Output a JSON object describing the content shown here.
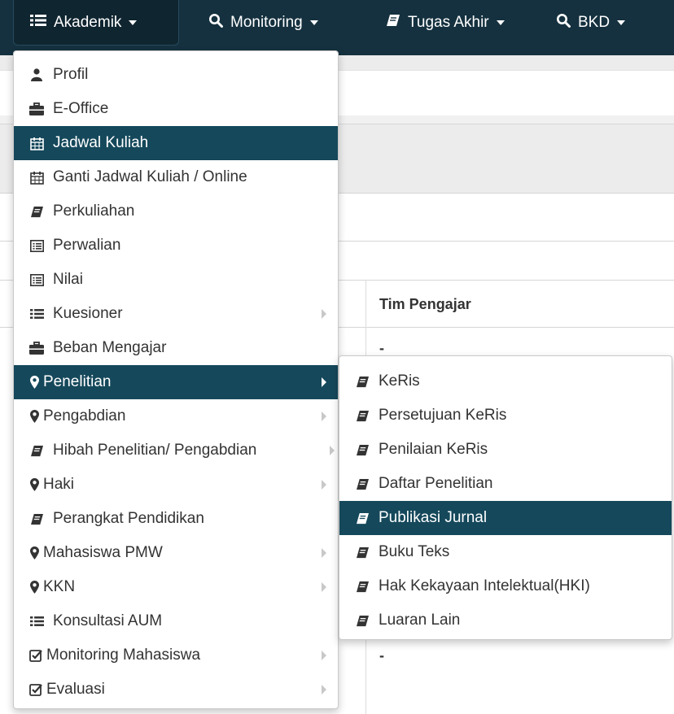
{
  "navbar": {
    "items": [
      {
        "label": "Akademik",
        "icon": "list-icon"
      },
      {
        "label": "Monitoring",
        "icon": "search-icon"
      },
      {
        "label": "Tugas Akhir",
        "icon": "book-icon"
      },
      {
        "label": "BKD",
        "icon": "search-icon"
      }
    ]
  },
  "table": {
    "header_tim_pengajar": "Tim Pengajar",
    "dash": "-"
  },
  "akademik_menu": {
    "items": [
      {
        "label": "Profil",
        "icon": "user-icon"
      },
      {
        "label": "E-Office",
        "icon": "briefcase-icon"
      },
      {
        "label": "Jadwal Kuliah",
        "icon": "calendar-icon"
      },
      {
        "label": "Ganti Jadwal Kuliah / Online",
        "icon": "calendar-icon"
      },
      {
        "label": "Perkuliahan",
        "icon": "book-icon"
      },
      {
        "label": "Perwalian",
        "icon": "list-alt-icon"
      },
      {
        "label": "Nilai",
        "icon": "list-alt-icon"
      },
      {
        "label": "Kuesioner",
        "icon": "list-icon"
      },
      {
        "label": "Beban Mengajar",
        "icon": "briefcase-icon"
      },
      {
        "label": "Penelitian",
        "icon": "map-marker-icon"
      },
      {
        "label": "Pengabdian",
        "icon": "map-marker-icon"
      },
      {
        "label": "Hibah Penelitian/ Pengabdian",
        "icon": "book-icon"
      },
      {
        "label": "Haki",
        "icon": "map-marker-icon"
      },
      {
        "label": "Perangkat Pendidikan",
        "icon": "book-icon"
      },
      {
        "label": "Mahasiswa PMW",
        "icon": "map-marker-icon"
      },
      {
        "label": "KKN",
        "icon": "map-marker-icon"
      },
      {
        "label": "Konsultasi AUM",
        "icon": "list-icon"
      },
      {
        "label": "Monitoring Mahasiswa",
        "icon": "check-square-icon"
      },
      {
        "label": "Evaluasi",
        "icon": "check-square-icon"
      }
    ]
  },
  "penelitian_submenu": {
    "items": [
      {
        "label": "KeRis",
        "icon": "book-icon"
      },
      {
        "label": "Persetujuan KeRis",
        "icon": "book-icon"
      },
      {
        "label": "Penilaian KeRis",
        "icon": "book-icon"
      },
      {
        "label": "Daftar Penelitian",
        "icon": "book-icon"
      },
      {
        "label": "Publikasi Jurnal",
        "icon": "book-icon"
      },
      {
        "label": "Buku Teks",
        "icon": "book-icon"
      },
      {
        "label": "Hak Kekayaan Intelektual(HKI)",
        "icon": "book-icon"
      },
      {
        "label": "Luaran Lain",
        "icon": "book-icon"
      }
    ]
  },
  "colors": {
    "navbar_bg": "#15313f",
    "highlight_bg": "#15485b"
  }
}
